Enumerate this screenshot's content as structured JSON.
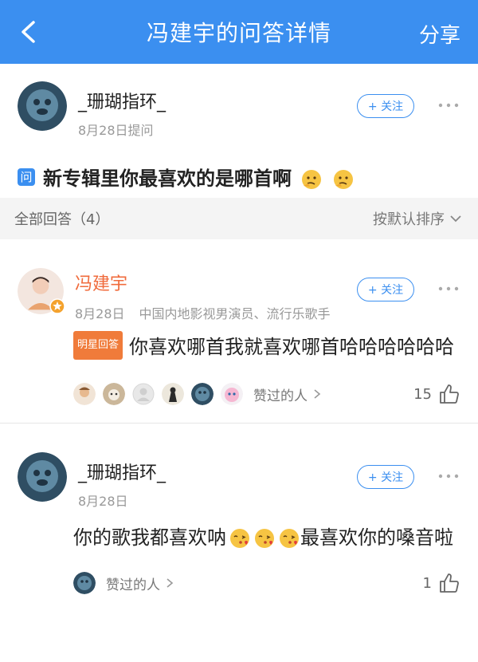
{
  "nav": {
    "title": "冯建宇的问答详情",
    "share": "分享"
  },
  "question": {
    "author": "_珊瑚指环_",
    "date": "8月28日提问",
    "follow": "+ 关注",
    "badge": "问",
    "text": "新专辑里你最喜欢的是哪首啊"
  },
  "sort": {
    "count_label": "全部回答（4）",
    "order": "按默认排序"
  },
  "answers": [
    {
      "author": "冯建宇",
      "date": "8月28日",
      "role": "中国内地影视男演员、流行乐歌手",
      "follow": "+ 关注",
      "badge": "明星回答",
      "text": "你喜欢哪首我就喜欢哪首哈哈哈哈哈哈",
      "likers_label": "赞过的人",
      "likes": "15"
    },
    {
      "author": "_珊瑚指环_",
      "date": "8月28日",
      "follow": "+ 关注",
      "text_a": "你的歌我都喜欢呐",
      "text_b": "最喜欢你的嗓音啦",
      "likers_label": "赞过的人",
      "likes": "1"
    }
  ],
  "colors": {
    "nav_bg": "#3b8ff0",
    "accent": "#3b8ff0",
    "celebrity": "#f06b3c"
  }
}
